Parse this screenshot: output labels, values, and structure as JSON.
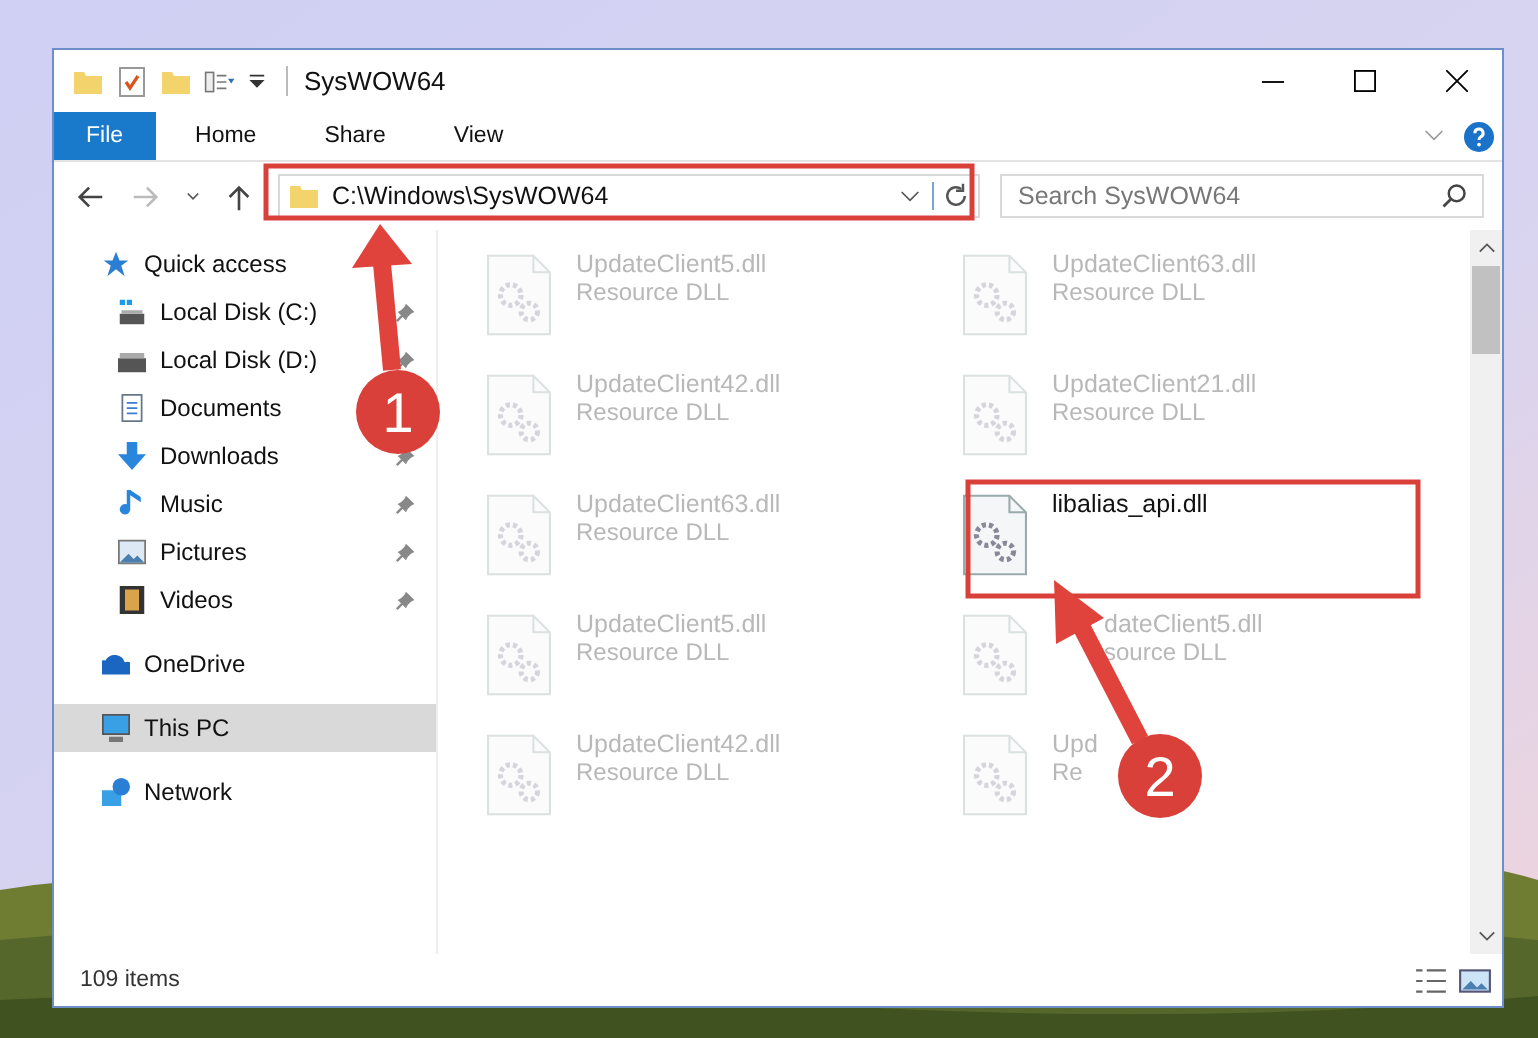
{
  "window": {
    "title": "SysWOW64"
  },
  "ribbon": {
    "tabs": [
      {
        "label": "File",
        "selected": true
      },
      {
        "label": "Home",
        "selected": false
      },
      {
        "label": "Share",
        "selected": false
      },
      {
        "label": "View",
        "selected": false
      }
    ]
  },
  "address_bar": {
    "path": "C:\\Windows\\SysWOW64"
  },
  "search": {
    "placeholder": "Search SysWOW64"
  },
  "sidebar": {
    "items": [
      {
        "label": "Quick access",
        "kind": "group",
        "selected": false,
        "pinned": false
      },
      {
        "label": "Local Disk (C:)",
        "kind": "item",
        "selected": false,
        "pinned": true
      },
      {
        "label": "Local Disk (D:)",
        "kind": "item",
        "selected": false,
        "pinned": true
      },
      {
        "label": "Documents",
        "kind": "item",
        "selected": false,
        "pinned": false
      },
      {
        "label": "Downloads",
        "kind": "item",
        "selected": false,
        "pinned": true
      },
      {
        "label": "Music",
        "kind": "item",
        "selected": false,
        "pinned": true
      },
      {
        "label": "Pictures",
        "kind": "item",
        "selected": false,
        "pinned": true
      },
      {
        "label": "Videos",
        "kind": "item",
        "selected": false,
        "pinned": true
      },
      {
        "label": "OneDrive",
        "kind": "group",
        "selected": false,
        "pinned": false
      },
      {
        "label": "This PC",
        "kind": "group",
        "selected": true,
        "pinned": false
      },
      {
        "label": "Network",
        "kind": "group",
        "selected": false,
        "pinned": false
      }
    ]
  },
  "files": [
    {
      "name": "UpdateClient5.dll",
      "type": "Resource DLL",
      "faded": true,
      "kind": "plain"
    },
    {
      "name": "UpdateClient63.dll",
      "type": "Resource DLL",
      "faded": true,
      "kind": "plain"
    },
    {
      "name": "UpdateClient42.dll",
      "type": "Resource DLL",
      "faded": true,
      "kind": "plain"
    },
    {
      "name": "UpdateClient21.dll",
      "type": "Resource DLL",
      "faded": true,
      "kind": "plain"
    },
    {
      "name": "UpdateClient63.dll",
      "type": "Resource DLL",
      "faded": true,
      "kind": "plain"
    },
    {
      "name": "libalias_api.dll",
      "faded": false,
      "kind": "plain"
    },
    {
      "name": "UpdateClient5.dll",
      "type": "Resource DLL",
      "faded": true,
      "kind": "plain"
    },
    {
      "name": "dateClient5.dll",
      "type": "source DLL",
      "faded": true,
      "kind": "covered"
    },
    {
      "name": "UpdateClient42.dll",
      "type": "Resource DLL",
      "faded": true,
      "kind": "plain"
    },
    {
      "name": "Upd",
      "type": "Re",
      "faded": true,
      "kind": "plain"
    }
  ],
  "status_bar": {
    "count": "109 items"
  },
  "annotations": [
    {
      "label": "1"
    },
    {
      "label": "2"
    }
  ]
}
